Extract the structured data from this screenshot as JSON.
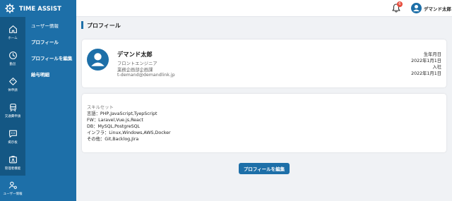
{
  "header": {
    "app_name": "TIME ASSIST",
    "notification_count": "6",
    "user_name": "デマンド太郎"
  },
  "nav": {
    "items": [
      {
        "label": "ホーム",
        "icon": "home-icon"
      },
      {
        "label": "勤怠",
        "icon": "clock-icon"
      },
      {
        "label": "休申請",
        "icon": "tag-icon"
      },
      {
        "label": "交通費申請",
        "icon": "train-icon"
      },
      {
        "label": "掲示板",
        "icon": "chat-icon"
      },
      {
        "label": "管理者機能",
        "icon": "admin-icon"
      },
      {
        "label": "ユーザー情報",
        "icon": "user-settings-icon",
        "active": true
      }
    ]
  },
  "submenu": {
    "title": "ユーザー情報",
    "items": [
      {
        "label": "プロフィール"
      },
      {
        "label": "プロフィールを編集"
      },
      {
        "label": "給与明細"
      }
    ]
  },
  "page": {
    "title": "プロフィール"
  },
  "profile": {
    "name": "デマンド太郎",
    "position": "フロントエンジニア",
    "department": "業務企画部企画課",
    "email": "t-demand@demandlink.jp",
    "birthday_label": "生年月日",
    "birthday": "2022年1月1日",
    "joined_label": "入社",
    "joined": "2022年1月1日"
  },
  "skills": {
    "title": "スキルセット",
    "lines": [
      "言語：PHP,JavaScript,TyepScript",
      "FW：Laravel,Vue.js,React",
      "DB：MySQL,PostgreSQL",
      "インフラ：Linux,Windows,AWS,Docker",
      "その他：Git,Backlog,Jira"
    ]
  },
  "actions": {
    "edit_label": "プロフィールを編集"
  },
  "colors": {
    "primary": "#1d6fa8",
    "nav_dark": "#145784",
    "badge": "#e74c3c",
    "background": "#f0f2f5"
  }
}
